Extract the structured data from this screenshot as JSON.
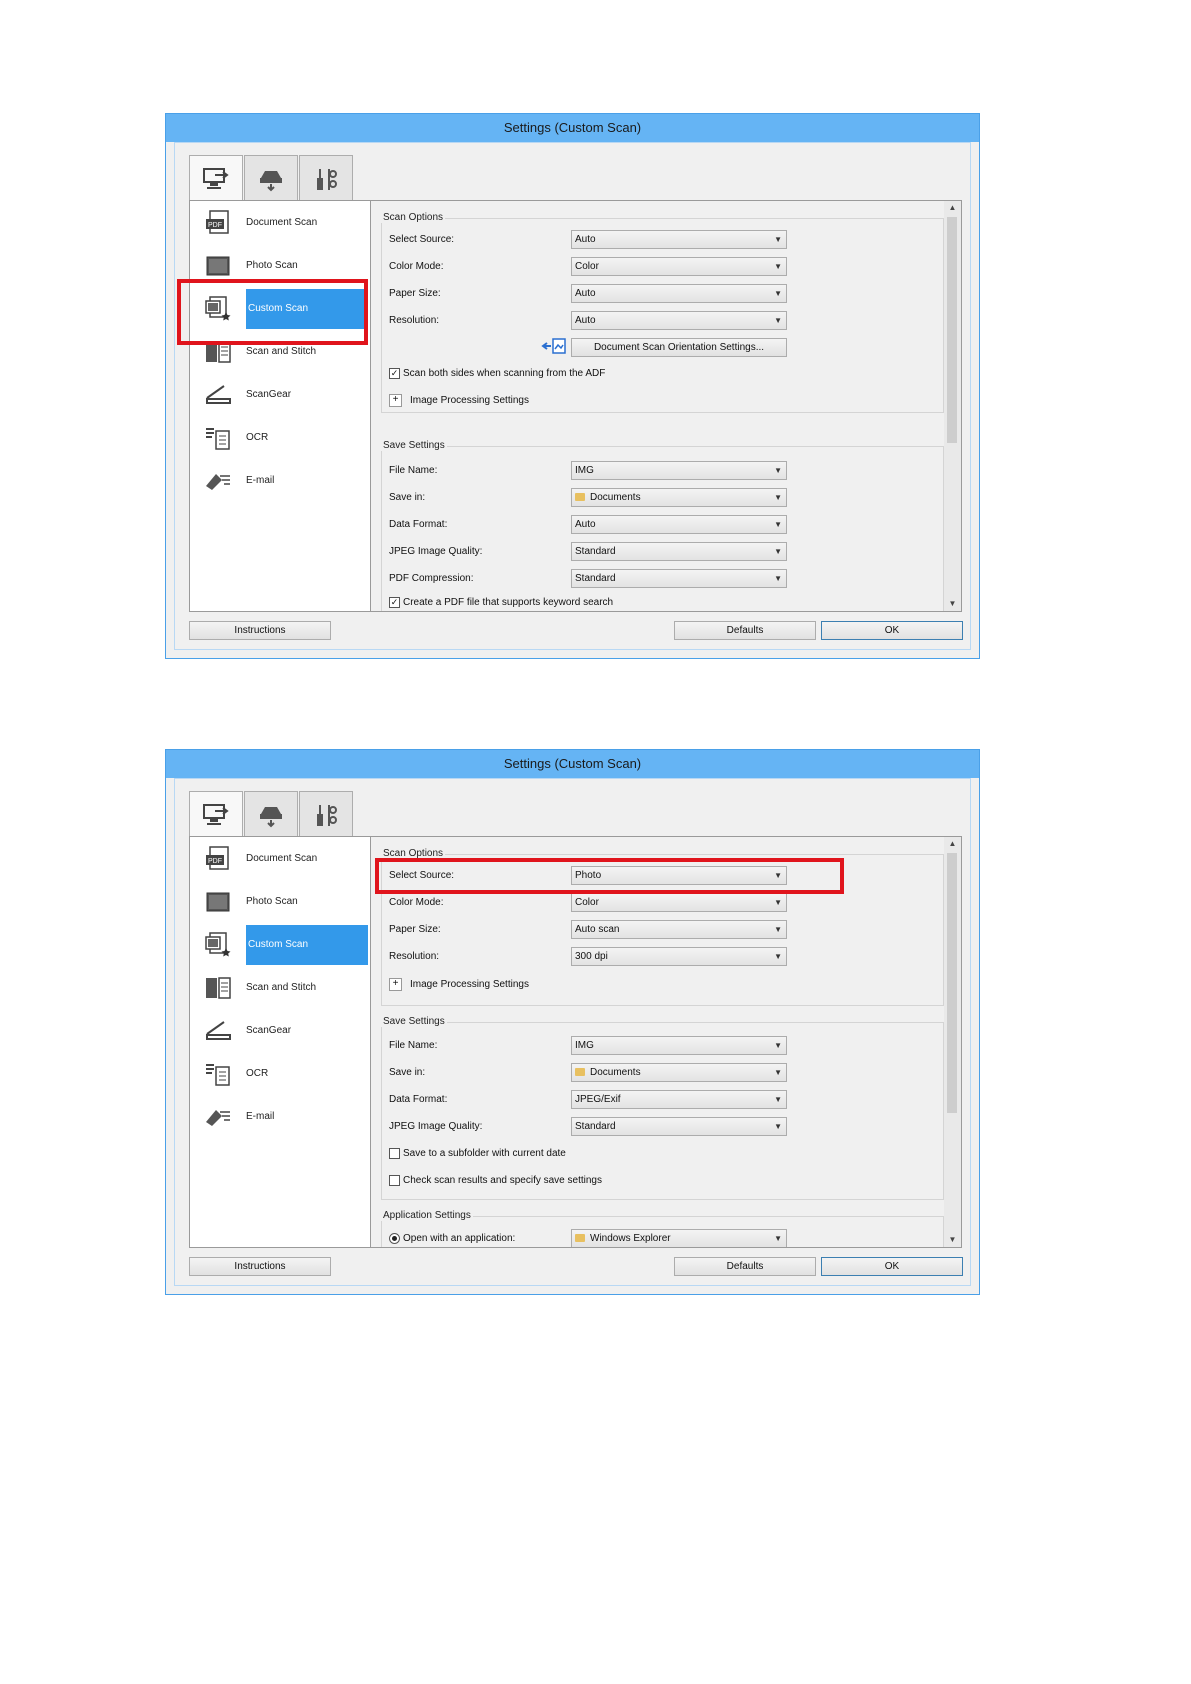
{
  "dialog1": {
    "title": "Settings (Custom Scan)",
    "tabs": [
      "scan-from-computer-icon",
      "scan-from-operation-panel-icon",
      "general-settings-icon"
    ],
    "nav": [
      {
        "label": "Document Scan",
        "icon": "document-scan-icon"
      },
      {
        "label": "Photo Scan",
        "icon": "photo-scan-icon"
      },
      {
        "label": "Custom Scan",
        "icon": "custom-scan-icon"
      },
      {
        "label": "Scan and Stitch",
        "icon": "scan-and-stitch-icon"
      },
      {
        "label": "ScanGear",
        "icon": "scangear-icon"
      },
      {
        "label": "OCR",
        "icon": "ocr-icon"
      },
      {
        "label": "E-mail",
        "icon": "email-icon"
      }
    ],
    "scan_options": {
      "title": "Scan Options",
      "select_source": {
        "label": "Select Source:",
        "value": "Auto"
      },
      "color_mode": {
        "label": "Color Mode:",
        "value": "Color"
      },
      "paper_size": {
        "label": "Paper Size:",
        "value": "Auto"
      },
      "resolution": {
        "label": "Resolution:",
        "value": "Auto"
      },
      "orientation_button": "Document Scan Orientation Settings...",
      "scan_both_sides": "Scan both sides when scanning from the ADF",
      "image_processing": "Image Processing Settings"
    },
    "save_settings": {
      "title": "Save Settings",
      "file_name": {
        "label": "File Name:",
        "value": "IMG"
      },
      "save_in": {
        "label": "Save in:",
        "value": "Documents"
      },
      "data_format": {
        "label": "Data Format:",
        "value": "Auto"
      },
      "jpeg_quality": {
        "label": "JPEG Image Quality:",
        "value": "Standard"
      },
      "pdf_compression": {
        "label": "PDF Compression:",
        "value": "Standard"
      },
      "keyword_pdf": "Create a PDF file that supports keyword search"
    },
    "buttons": {
      "instructions": "Instructions",
      "defaults": "Defaults",
      "ok": "OK"
    }
  },
  "dialog2": {
    "title": "Settings (Custom Scan)",
    "nav": [
      {
        "label": "Document Scan"
      },
      {
        "label": "Photo Scan"
      },
      {
        "label": "Custom Scan"
      },
      {
        "label": "Scan and Stitch"
      },
      {
        "label": "ScanGear"
      },
      {
        "label": "OCR"
      },
      {
        "label": "E-mail"
      }
    ],
    "scan_options": {
      "title": "Scan Options",
      "select_source": {
        "label": "Select Source:",
        "value": "Photo"
      },
      "color_mode": {
        "label": "Color Mode:",
        "value": "Color"
      },
      "paper_size": {
        "label": "Paper Size:",
        "value": "Auto scan"
      },
      "resolution": {
        "label": "Resolution:",
        "value": "300 dpi"
      },
      "image_processing": "Image Processing Settings"
    },
    "save_settings": {
      "title": "Save Settings",
      "file_name": {
        "label": "File Name:",
        "value": "IMG"
      },
      "save_in": {
        "label": "Save in:",
        "value": "Documents"
      },
      "data_format": {
        "label": "Data Format:",
        "value": "JPEG/Exif"
      },
      "jpeg_quality": {
        "label": "JPEG Image Quality:",
        "value": "Standard"
      },
      "subfolder": "Save to a subfolder with current date",
      "check_results": "Check scan results and specify save settings"
    },
    "app_settings": {
      "title": "Application Settings",
      "open_with": {
        "label": "Open with an application:",
        "value": "Windows Explorer"
      }
    },
    "buttons": {
      "instructions": "Instructions",
      "defaults": "Defaults",
      "ok": "OK"
    }
  },
  "colors": {
    "titlebar": "#65b4f4",
    "selection": "#3399ea",
    "highlight": "#e0141c"
  }
}
